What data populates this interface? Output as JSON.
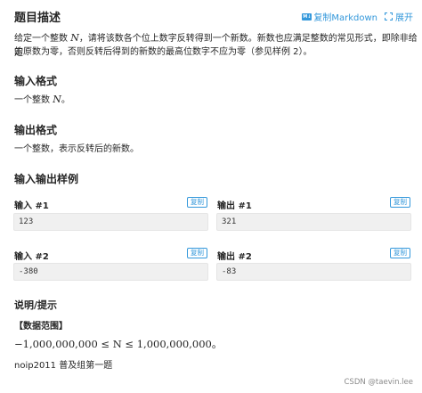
{
  "header": {
    "title": "题目描述",
    "copy_markdown_icon": "markdown-icon",
    "copy_markdown_label": "复制Markdown",
    "expand_icon": "expand-icon",
    "expand_label": "展开"
  },
  "description": {
    "line1_pre": "给定一个整数 ",
    "line1_var": "N",
    "line1_post": "，请将该数各个位上数字反转得到一个新数。新数也应满足整数的常见形式，即除非给定",
    "line2": "的原数为零，否则反转后得到的新数的最高位数字不应为零（参见样例 2）。"
  },
  "input_format": {
    "heading": "输入格式",
    "text_pre": "一个整数 ",
    "text_var": "N",
    "text_post": "。"
  },
  "output_format": {
    "heading": "输出格式",
    "text": "一个整数，表示反转后的新数。"
  },
  "samples": {
    "heading": "输入输出样例",
    "copy_label": "复制",
    "items": [
      {
        "input_label": "输入 #1",
        "input": "123",
        "output_label": "输出 #1",
        "output": "321"
      },
      {
        "input_label": "输入 #2",
        "input": "-380",
        "output_label": "输出 #2",
        "output": "-83"
      }
    ]
  },
  "hint": {
    "heading": "说明/提示",
    "range_label": "【数据范围】",
    "range_formula": "−1,000,000,000 ≤ N ≤ 1,000,000,000。",
    "source": "noip2011 普及组第一题"
  },
  "watermark": "CSDN @taevin.lee"
}
